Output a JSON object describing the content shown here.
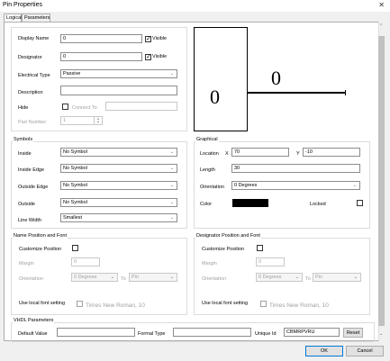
{
  "window": {
    "title": "Pin Properties"
  },
  "tabs": [
    "Logical",
    "Parameters"
  ],
  "logical": {
    "display_name_label": "Display Name",
    "display_name_value": "0",
    "visible_label": "Visible",
    "designator_label": "Designator",
    "designator_value": "0",
    "electrical_type_label": "Electrical Type",
    "electrical_type_value": "Passive",
    "description_label": "Description",
    "description_value": "",
    "hide_label": "Hide",
    "connect_to_label": "Connect To",
    "part_number_label": "Part Number",
    "part_number_value": "1"
  },
  "preview": {
    "left_text": "0",
    "right_text": "0"
  },
  "symbols": {
    "title": "Symbols",
    "inside_label": "Inside",
    "inside_value": "No Symbol",
    "inside_edge_label": "Inside Edge",
    "inside_edge_value": "No Symbol",
    "outside_edge_label": "Outside Edge",
    "outside_edge_value": "No Symbol",
    "outside_label": "Outside",
    "outside_value": "No Symbol",
    "line_width_label": "Line Width",
    "line_width_value": "Smallest"
  },
  "graphical": {
    "title": "Graphical",
    "location_label": "Location",
    "x_label": "X",
    "x_value": "70",
    "y_label": "Y",
    "y_value": "-10",
    "length_label": "Length",
    "length_value": "30",
    "orientation_label": "Orientation",
    "orientation_value": "0 Degrees",
    "color_label": "Color",
    "color_value": "#000000",
    "locked_label": "Locked"
  },
  "name_font": {
    "title": "Name Position and Font",
    "customize_label": "Customize Position",
    "margin_label": "Margin",
    "margin_value": "0",
    "orientation_label": "Orientation",
    "orientation_value": "0 Degrees",
    "to_label": "To",
    "to_value": "Pin",
    "local_font_label": "Use local font setting",
    "font_value": "Times New Roman, 10"
  },
  "designator_font": {
    "title": "Designator Position and Font",
    "customize_label": "Customize Position",
    "margin_label": "Margin",
    "margin_value": "0",
    "orientation_label": "Orientation",
    "orientation_value": "0 Degrees",
    "to_label": "To",
    "to_value": "Pin",
    "local_font_label": "Use local font setting",
    "font_value": "Times New Roman, 10"
  },
  "vhdl": {
    "title": "VHDL Parameters",
    "default_value_label": "Default Value",
    "default_value_value": "",
    "formal_type_label": "Formal Type",
    "formal_type_value": "",
    "unique_id_label": "Unique Id",
    "unique_id_value": "CBMRPVRU",
    "reset_label": "Reset"
  },
  "buttons": {
    "ok": "OK",
    "cancel": "Cancel"
  }
}
